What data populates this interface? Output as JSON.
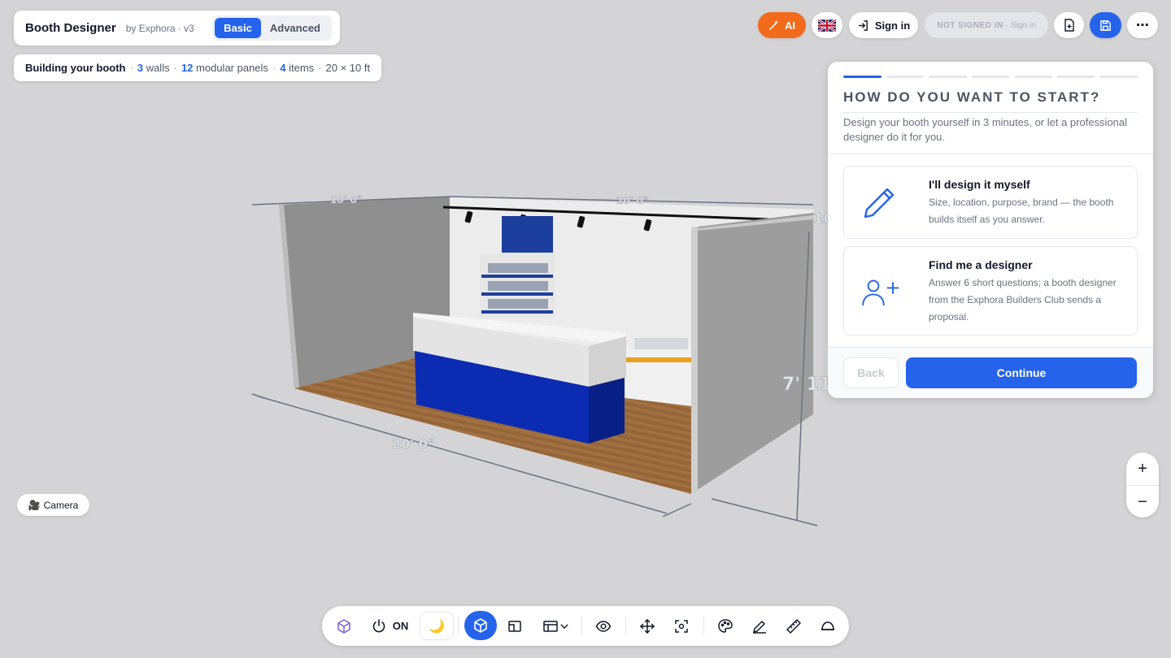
{
  "header": {
    "title": "Booth Designer",
    "subtitle": "by Exphora · v3",
    "modes": [
      "Basic",
      "Advanced"
    ],
    "active_mode": "Basic"
  },
  "stats": {
    "prefix": "Building your booth",
    "walls_count": "3",
    "walls_label": "walls",
    "panels_count": "12",
    "panels_label": "modular panels",
    "items_count": "4",
    "items_label": "items",
    "size": "20 × 10 ft"
  },
  "topbar": {
    "ai_label": "AI",
    "language_icon": "uk-flag-icon",
    "signin_label": "Sign in",
    "status_label": "NOT SIGNED IN",
    "status_link": "Sign in"
  },
  "scene": {
    "dim_left_top": "10' 0\"",
    "dim_back": "20' 0\"",
    "dim_front": "20' 0\"",
    "dim_height": "7' 11",
    "dim_right_top": "10"
  },
  "wizard": {
    "steps_total": 7,
    "step_current": 1,
    "title": "HOW DO YOU WANT TO START?",
    "description": "Design your booth yourself in 3 minutes, or let a professional designer do it for you.",
    "option1_title": "I'll design it myself",
    "option1_desc": "Size, location, purpose, brand — the booth builds itself as you answer.",
    "option2_title": "Find me a designer",
    "option2_desc": "Answer 6 short questions; a booth designer from the Exphora Builders Club sends a proposal.",
    "back_label": "Back",
    "continue_label": "Continue"
  },
  "camera_label": "Camera",
  "zoom": {
    "in": "+",
    "out": "−"
  },
  "toolbar": {
    "power_label": "ON",
    "icons": [
      "cube-outline-icon",
      "power-icon",
      "moon-icon",
      "cube-icon",
      "floorplan-icon",
      "layout-icon",
      "eye-icon",
      "move-icon",
      "focus-icon",
      "palette-icon",
      "pen-icon",
      "ruler-icon",
      "dome-light-icon"
    ]
  },
  "colors": {
    "accent": "#2563eb",
    "ai_orange": "#f26a1b",
    "counter_blue": "#0b2bb3",
    "floor_wood": "#9a6a3c"
  }
}
